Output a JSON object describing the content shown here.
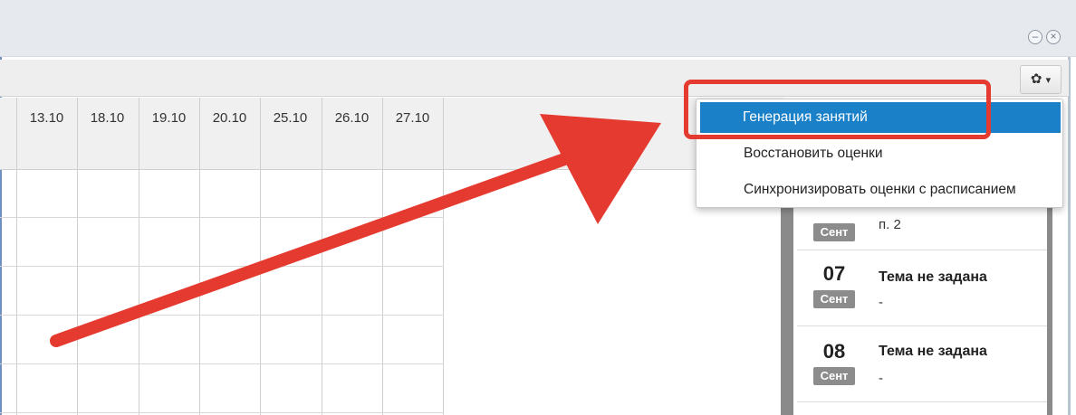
{
  "window": {
    "minimize_glyph": "–",
    "close_glyph": "×"
  },
  "toolbar": {
    "gear_icon": "gear-icon",
    "gear_glyph": "✿",
    "caret_glyph": "▾"
  },
  "grid": {
    "columns": [
      "13.10",
      "18.10",
      "19.10",
      "20.10",
      "25.10",
      "26.10",
      "27.10"
    ]
  },
  "settings_menu": {
    "items": [
      {
        "label": "Генерация занятий",
        "active": true
      },
      {
        "label": "Восстановить оценки",
        "active": false
      },
      {
        "label": "Синхронизировать оценки с расписанием",
        "active": false
      }
    ]
  },
  "lessons": [
    {
      "day": "",
      "month": "Сент",
      "title": "",
      "subtitle": "п. 2"
    },
    {
      "day": "07",
      "month": "Сент",
      "title": "Тема не задана",
      "subtitle": "-"
    },
    {
      "day": "08",
      "month": "Сент",
      "title": "Тема не задана",
      "subtitle": "-"
    }
  ],
  "annotation": {
    "arrow_color": "#e53a2f",
    "highlight_color": "#e53a2f",
    "accent_color": "#1a80c8"
  }
}
